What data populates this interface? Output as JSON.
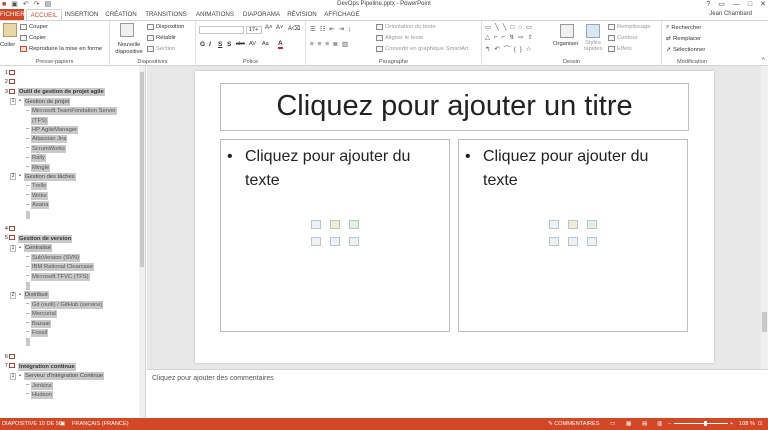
{
  "window": {
    "title": "DevOps Pipeline.pptx - PowerPoint",
    "qat_icons": [
      "app-icon",
      "save-icon",
      "undo-icon",
      "redo-icon",
      "start-slideshow-icon"
    ],
    "controls": [
      "?",
      "▭",
      "—",
      "□",
      "✕"
    ]
  },
  "tabs": [
    "FICHIER",
    "ACCUEIL",
    "INSERTION",
    "CRÉATION",
    "TRANSITIONS",
    "ANIMATIONS",
    "DIAPORAMA",
    "RÉVISION",
    "AFFICHAGE"
  ],
  "active_tab": "ACCUEIL",
  "user": "Jean Chambard",
  "ribbon": {
    "clipboard": {
      "paste": "Coller",
      "cut": "Couper",
      "copy": "Copier",
      "format_painter": "Reproduire la mise en forme",
      "label": "Presse-papiers"
    },
    "slides": {
      "new_slide": "Nouvelle diapositive",
      "layout": "Disposition",
      "reset": "Rétablir",
      "section": "Section",
      "label": "Diapositives"
    },
    "font": {
      "font_name": "",
      "font_size": "17+",
      "label": "Police",
      "buttons": [
        "G",
        "I",
        "S",
        "S",
        "abc",
        "AV",
        "Aa",
        "A"
      ]
    },
    "paragraph": {
      "text_direction": "Orientation du texte",
      "align_text": "Aligner le texte",
      "smartart": "Convertir en graphique SmartArt",
      "label": "Paragraphe"
    },
    "drawing": {
      "arrange": "Organiser",
      "quick_styles": "Styles rapides",
      "fill": "Remplissage",
      "outline": "Contour",
      "effects": "Effets",
      "label": "Dessin"
    },
    "editing": {
      "find": "Rechercher",
      "replace": "Remplacer",
      "select": "Sélectionner",
      "label": "Modification"
    }
  },
  "outline": [
    {
      "kind": "slide",
      "num": "1",
      "text": ""
    },
    {
      "kind": "slide",
      "num": "2",
      "text": ""
    },
    {
      "kind": "slide",
      "num": "3",
      "text": "Outil de gestion de projet agile"
    },
    {
      "kind": "bullet",
      "num": "1",
      "text": "Gestion de projet"
    },
    {
      "kind": "sub",
      "text": "Microsoft TeamFondation Server"
    },
    {
      "kind": "subcont",
      "text": "(TFS)"
    },
    {
      "kind": "sub",
      "text": "HP AgileManager"
    },
    {
      "kind": "sub",
      "text": "Atlassian Jira"
    },
    {
      "kind": "sub",
      "text": "ScrumWorks"
    },
    {
      "kind": "sub",
      "text": "Rally"
    },
    {
      "kind": "sub",
      "text": "Mingle"
    },
    {
      "kind": "bullet",
      "num": "2",
      "text": "Gestion des tâches"
    },
    {
      "kind": "sub",
      "text": "Trello"
    },
    {
      "kind": "sub",
      "text": "Wrike"
    },
    {
      "kind": "sub",
      "text": "Asana"
    },
    {
      "kind": "empty",
      "text": ""
    },
    {
      "kind": "gap",
      "text": ""
    },
    {
      "kind": "slide",
      "num": "4",
      "text": ""
    },
    {
      "kind": "slide",
      "num": "5",
      "text": "Gestion de version"
    },
    {
      "kind": "bullet",
      "num": "1",
      "text": "Centralisé"
    },
    {
      "kind": "sub",
      "text": "SubVersion (SVN)"
    },
    {
      "kind": "sub",
      "text": "IBM Rational Clearcase"
    },
    {
      "kind": "sub",
      "text": "Microsoft TFVC (TFS)"
    },
    {
      "kind": "empty",
      "text": ""
    },
    {
      "kind": "bullet",
      "num": "2",
      "text": "Distribué"
    },
    {
      "kind": "sub",
      "text": "Git (outil) / GitHub (service)"
    },
    {
      "kind": "sub",
      "text": "Mercurial"
    },
    {
      "kind": "sub",
      "text": "Bazaar"
    },
    {
      "kind": "sub",
      "text": "Fossil"
    },
    {
      "kind": "empty",
      "text": ""
    },
    {
      "kind": "gap",
      "text": ""
    },
    {
      "kind": "slide",
      "num": "6",
      "text": ""
    },
    {
      "kind": "slide",
      "num": "7",
      "text": "Intégration continue"
    },
    {
      "kind": "bullet",
      "num": "1",
      "text": "Serveur d'intégration Continue"
    },
    {
      "kind": "sub",
      "text": "Jenkins"
    },
    {
      "kind": "sub",
      "text": "Hudson"
    }
  ],
  "slide": {
    "title_placeholder": "Cliquez pour ajouter un titre",
    "left_placeholder": "Cliquez pour ajouter du texte",
    "right_placeholder": "Cliquez pour ajouter du texte",
    "bullet": "•"
  },
  "notes_placeholder": "Cliquez pour ajouter des commentaires",
  "status": {
    "slide_counter": "DIAPOSITIVE 10 DE 50",
    "language": "FRANÇAIS (FRANCE)",
    "comments": "COMMENTAIRES",
    "zoom": "108 %",
    "zoom_level_fraction": 0.58
  },
  "colors": {
    "accent": "#d24726",
    "outline_highlight": "#c9c9c9"
  }
}
